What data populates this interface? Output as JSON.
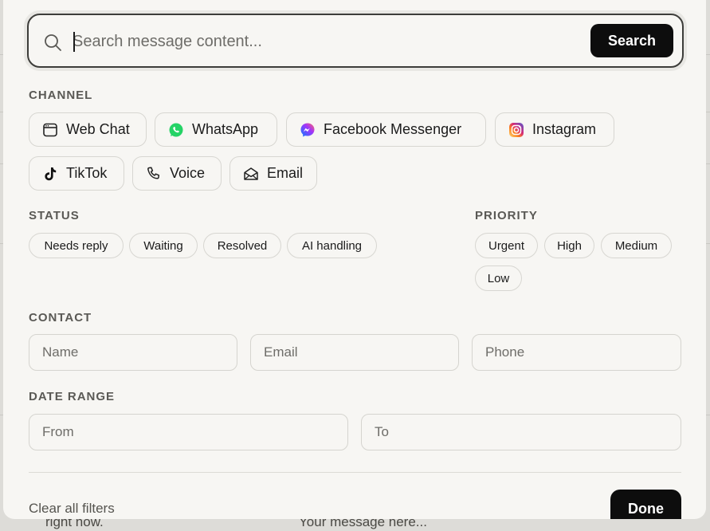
{
  "background": {
    "snippet_left": "right now.",
    "snippet_right": "Your message here..."
  },
  "search": {
    "placeholder": "Search message content...",
    "button_label": "Search"
  },
  "channel": {
    "label": "CHANNEL",
    "options": [
      {
        "label": "Web Chat",
        "icon": "web-chat-icon"
      },
      {
        "label": "WhatsApp",
        "icon": "whatsapp-icon",
        "color": "#25d366"
      },
      {
        "label": "Facebook Messenger",
        "icon": "messenger-icon",
        "color": "#a334fa"
      },
      {
        "label": "Instagram",
        "icon": "instagram-icon",
        "color": "#e1306c"
      },
      {
        "label": "TikTok",
        "icon": "tiktok-icon"
      },
      {
        "label": "Voice",
        "icon": "phone-icon"
      },
      {
        "label": "Email",
        "icon": "envelope-icon"
      }
    ]
  },
  "status": {
    "label": "STATUS",
    "options": [
      "Needs reply",
      "Waiting",
      "Resolved",
      "AI handling"
    ]
  },
  "priority": {
    "label": "PRIORITY",
    "options": [
      "Urgent",
      "High",
      "Medium",
      "Low"
    ]
  },
  "contact": {
    "label": "CONTACT",
    "name_placeholder": "Name",
    "email_placeholder": "Email",
    "phone_placeholder": "Phone"
  },
  "date_range": {
    "label": "DATE RANGE",
    "from_placeholder": "From",
    "to_placeholder": "To"
  },
  "footer": {
    "clear_label": "Clear all filters",
    "done_label": "Done"
  }
}
